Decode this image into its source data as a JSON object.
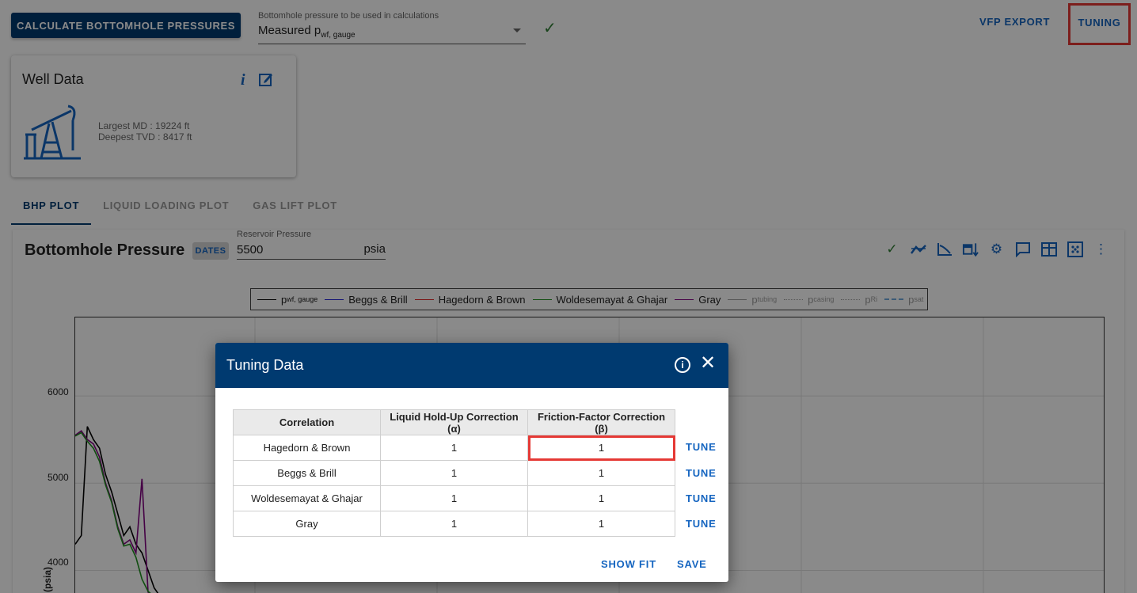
{
  "top_bar": {
    "calculate_label": "CALCULATE BOTTOMHOLE PRESSURES",
    "bhp_select_label": "Bottomhole pressure to be used in calculations",
    "bhp_select_value": "Measured p",
    "bhp_select_value_sub": "wf, gauge",
    "vfp_export_label": "VFP EXPORT",
    "tuning_label": "TUNING"
  },
  "well_card": {
    "title": "Well Data",
    "largest_md": "Largest MD :  19224 ft",
    "deepest_tvd": "Deepest TVD :  8417 ft"
  },
  "tabs": [
    {
      "label": "BHP PLOT",
      "active": true
    },
    {
      "label": "LIQUID LOADING PLOT",
      "active": false
    },
    {
      "label": "GAS LIFT PLOT",
      "active": false
    }
  ],
  "chart_panel": {
    "title": "Bottomhole Pressure",
    "dates_label": "DATES",
    "reservoir_label": "Reservoir Pressure",
    "reservoir_value": "5500",
    "reservoir_unit": "psia",
    "toolbar_icons": [
      "check-icon",
      "trend-icon",
      "axis-icon",
      "calendar-sort-icon",
      "gear-icon",
      "comment-icon",
      "table-icon",
      "fit-icon",
      "more-vert-icon"
    ]
  },
  "chart_data": {
    "type": "line",
    "legend": [
      {
        "name": "p",
        "sub": "wf, gauge",
        "color": "#000000",
        "style": "solid"
      },
      {
        "name": "Beggs & Brill",
        "sub": "",
        "color": "#1f1fd6",
        "style": "solid"
      },
      {
        "name": "Hagedorn & Brown",
        "sub": "",
        "color": "#e02020",
        "style": "solid"
      },
      {
        "name": "Woldesemayat & Ghajar",
        "sub": "",
        "color": "#1f8f1f",
        "style": "solid"
      },
      {
        "name": "Gray",
        "sub": "",
        "color": "#800080",
        "style": "solid"
      },
      {
        "name": "p",
        "sub": "tubing",
        "color": "#9e9e9e",
        "style": "solid"
      },
      {
        "name": "p",
        "sub": "casing",
        "color": "#9e9e9e",
        "style": "dotted"
      },
      {
        "name": "p",
        "sub": "Ri",
        "color": "#9e9e9e",
        "style": "dotted"
      },
      {
        "name": "p",
        "sub": "sat",
        "color": "#6fa8dc",
        "style": "dashed"
      }
    ],
    "ylabel": "(psia)",
    "yticks": [
      "6000",
      "5000",
      "4000"
    ],
    "ylim": [
      3650,
      6900
    ],
    "series": [
      {
        "name": "p_wf_gauge",
        "color": "#000000",
        "values": [
          4300,
          4400,
          5650,
          5500,
          5400,
          5100,
          4900,
          4650,
          4400,
          4500,
          4300,
          4200,
          4000,
          3800,
          3700,
          3650
        ]
      },
      {
        "name": "Gray",
        "color": "#800080",
        "values": [
          5550,
          5600,
          5500,
          5450,
          5300,
          5000,
          4800,
          4500,
          4300,
          4350,
          4200,
          5050,
          3750,
          3700,
          3680,
          3660
        ]
      },
      {
        "name": "Woldesemayat & Ghajar",
        "color": "#1f8f1f",
        "values": [
          5540,
          5580,
          5480,
          5400,
          5250,
          4980,
          4780,
          4480,
          4280,
          4300,
          4150,
          3900,
          3760,
          3700,
          3680,
          3660
        ]
      }
    ]
  },
  "dialog": {
    "title": "Tuning Data",
    "columns": [
      "Correlation",
      "Liquid Hold-Up Correction (α)",
      "Friction-Factor Correction (β)"
    ],
    "rows": [
      {
        "name": "Hagedorn & Brown",
        "alpha": "1",
        "beta": "1"
      },
      {
        "name": "Beggs & Brill",
        "alpha": "1",
        "beta": "1"
      },
      {
        "name": "Woldesemayat & Ghajar",
        "alpha": "1",
        "beta": "1"
      },
      {
        "name": "Gray",
        "alpha": "1",
        "beta": "1"
      }
    ],
    "tune_label": "TUNE",
    "show_fit_label": "SHOW FIT",
    "save_label": "SAVE"
  }
}
